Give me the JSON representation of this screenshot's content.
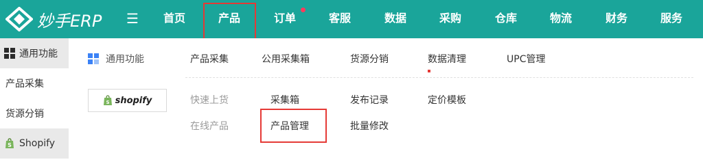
{
  "app": {
    "logo_text": "妙手ERP",
    "menu_icon": "hamburger-icon"
  },
  "nav": {
    "items": [
      {
        "label": "首页"
      },
      {
        "label": "产品",
        "active": true
      },
      {
        "label": "订单",
        "badge": true
      },
      {
        "label": "客服"
      },
      {
        "label": "数据"
      },
      {
        "label": "采购"
      },
      {
        "label": "仓库"
      },
      {
        "label": "物流"
      },
      {
        "label": "财务"
      },
      {
        "label": "服务"
      }
    ]
  },
  "sidebar": {
    "items": [
      {
        "label": "通用功能",
        "icon": "grid-icon",
        "active": true
      },
      {
        "label": "产品采集"
      },
      {
        "label": "货源分销"
      },
      {
        "label": "Shopify",
        "icon": "shopify-bag-icon"
      }
    ]
  },
  "dropdown": {
    "general": {
      "title": "通用功能",
      "icon": "grid-icon",
      "links": [
        "产品采集",
        "公用采集箱",
        "货源分销",
        "数据清理",
        "UPC管理"
      ]
    },
    "shopify": {
      "logo_text": "shopify",
      "row1": {
        "label": "快速上货",
        "links": [
          "采集箱",
          "发布记录",
          "定价模板"
        ]
      },
      "row2": {
        "label": "在线产品",
        "links": [
          "产品管理",
          "批量修改"
        ]
      }
    }
  },
  "colors": {
    "topbar": "#1aa59a",
    "highlight": "#e53935",
    "badge": "#ff3b5c"
  }
}
